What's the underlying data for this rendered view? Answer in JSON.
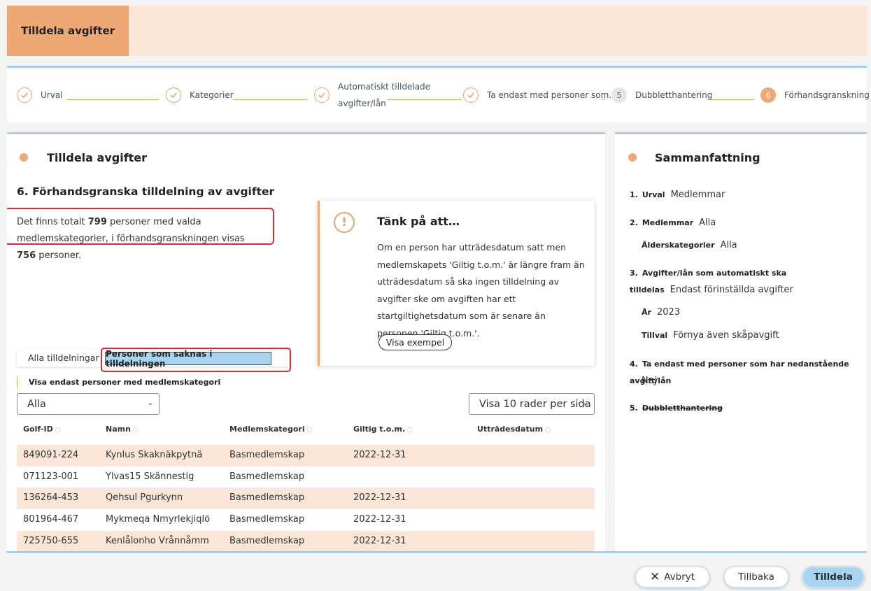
{
  "header": {
    "title": "Tilldela avgifter"
  },
  "stepper": {
    "steps": [
      {
        "label": "Urval",
        "state": "done"
      },
      {
        "label": "Kategorier",
        "state": "done"
      },
      {
        "label_line1": "Automatiskt tilldelade",
        "label_line2": "avgifter/lån",
        "state": "done"
      },
      {
        "label": "Ta endast med personer som…",
        "state": "done"
      },
      {
        "number": "5",
        "label": "Dubbletthantering",
        "state": "pending"
      },
      {
        "number": "6",
        "label": "Förhandsgranskning",
        "state": "current"
      }
    ]
  },
  "main": {
    "panel_title": "Tilldela avgifter",
    "section_title": "6. Förhandsgranska tilldelning av avgifter",
    "info": {
      "p1": "Det finns totalt ",
      "total": "799",
      "p2": " personer med valda medlemskategorier, i förhandsgranskningen visas ",
      "shown": "756",
      "p3": " personer."
    },
    "callout": {
      "icon": "exclamation-icon",
      "title": "Tänk på att…",
      "text": "Om en person har utträdesdatum satt men medlemskapets 'Giltig t.o.m.' är längre fram än utträdesdatum så ska ingen tilldelning av avgifter ske om avgiften har ett startgiltighetsdatum som är senare än personen 'Giltig t.o.m.'.",
      "button": "Visa exempel"
    },
    "tabs": {
      "all": "Alla tilldelningar",
      "missing": "Personer som saknas i tilldelningen"
    },
    "filter_label": "Visa endast personer med medlemskategori",
    "category_select": "Alla",
    "rows_select": "Visa 10 rader per sida",
    "table": {
      "headers": [
        "Golf-ID",
        "Namn",
        "Medlemskategori",
        "Giltig t.o.m.",
        "Utträdesdatum"
      ],
      "rows": [
        [
          "849091-224",
          "Kynlus Skaknäkpytnä",
          "Basmedlemskap",
          "2022-12-31",
          ""
        ],
        [
          "071123-001",
          "Ylvas15 Skännestig",
          "Basmedlemskap",
          "",
          ""
        ],
        [
          "136264-453",
          "Qehsul Pgurkynn",
          "Basmedlemskap",
          "2022-12-31",
          ""
        ],
        [
          "801964-467",
          "Mykmeqa Nmyrlekjiqlö",
          "Basmedlemskap",
          "2022-12-31",
          ""
        ],
        [
          "725750-655",
          "Kenlålonho Vrånnåmm",
          "Basmedlemskap",
          "2022-12-31",
          ""
        ]
      ]
    }
  },
  "summary": {
    "title": "Sammanfattning",
    "items": {
      "urval_n": "1.",
      "urval_k": "Urval",
      "urval_v": "Medlemmar",
      "medl_n": "2.",
      "medl_k": "Medlemmar",
      "medl_v": "Alla",
      "alder_k": "Ålderskategorier",
      "alder_v": "Alla",
      "avg_n": "3.",
      "avg_k": "Avgifter/lån som automatiskt ska tilldelas",
      "avg_v": "Endast förinställda avgifter",
      "ar_k": "År",
      "ar_v": "2023",
      "tillval_k": "Tillval",
      "tillval_v": "Förnya även skåpavgift",
      "ta_n": "4.",
      "ta_k": "Ta endast med personer som har nedanstående avgift/lån",
      "ta_v": "Nej",
      "dub_n": "5.",
      "dub_k": "Dubbletthantering"
    }
  },
  "footer": {
    "cancel": "Avbryt",
    "back": "Tillbaka",
    "submit": "Tilldela"
  }
}
